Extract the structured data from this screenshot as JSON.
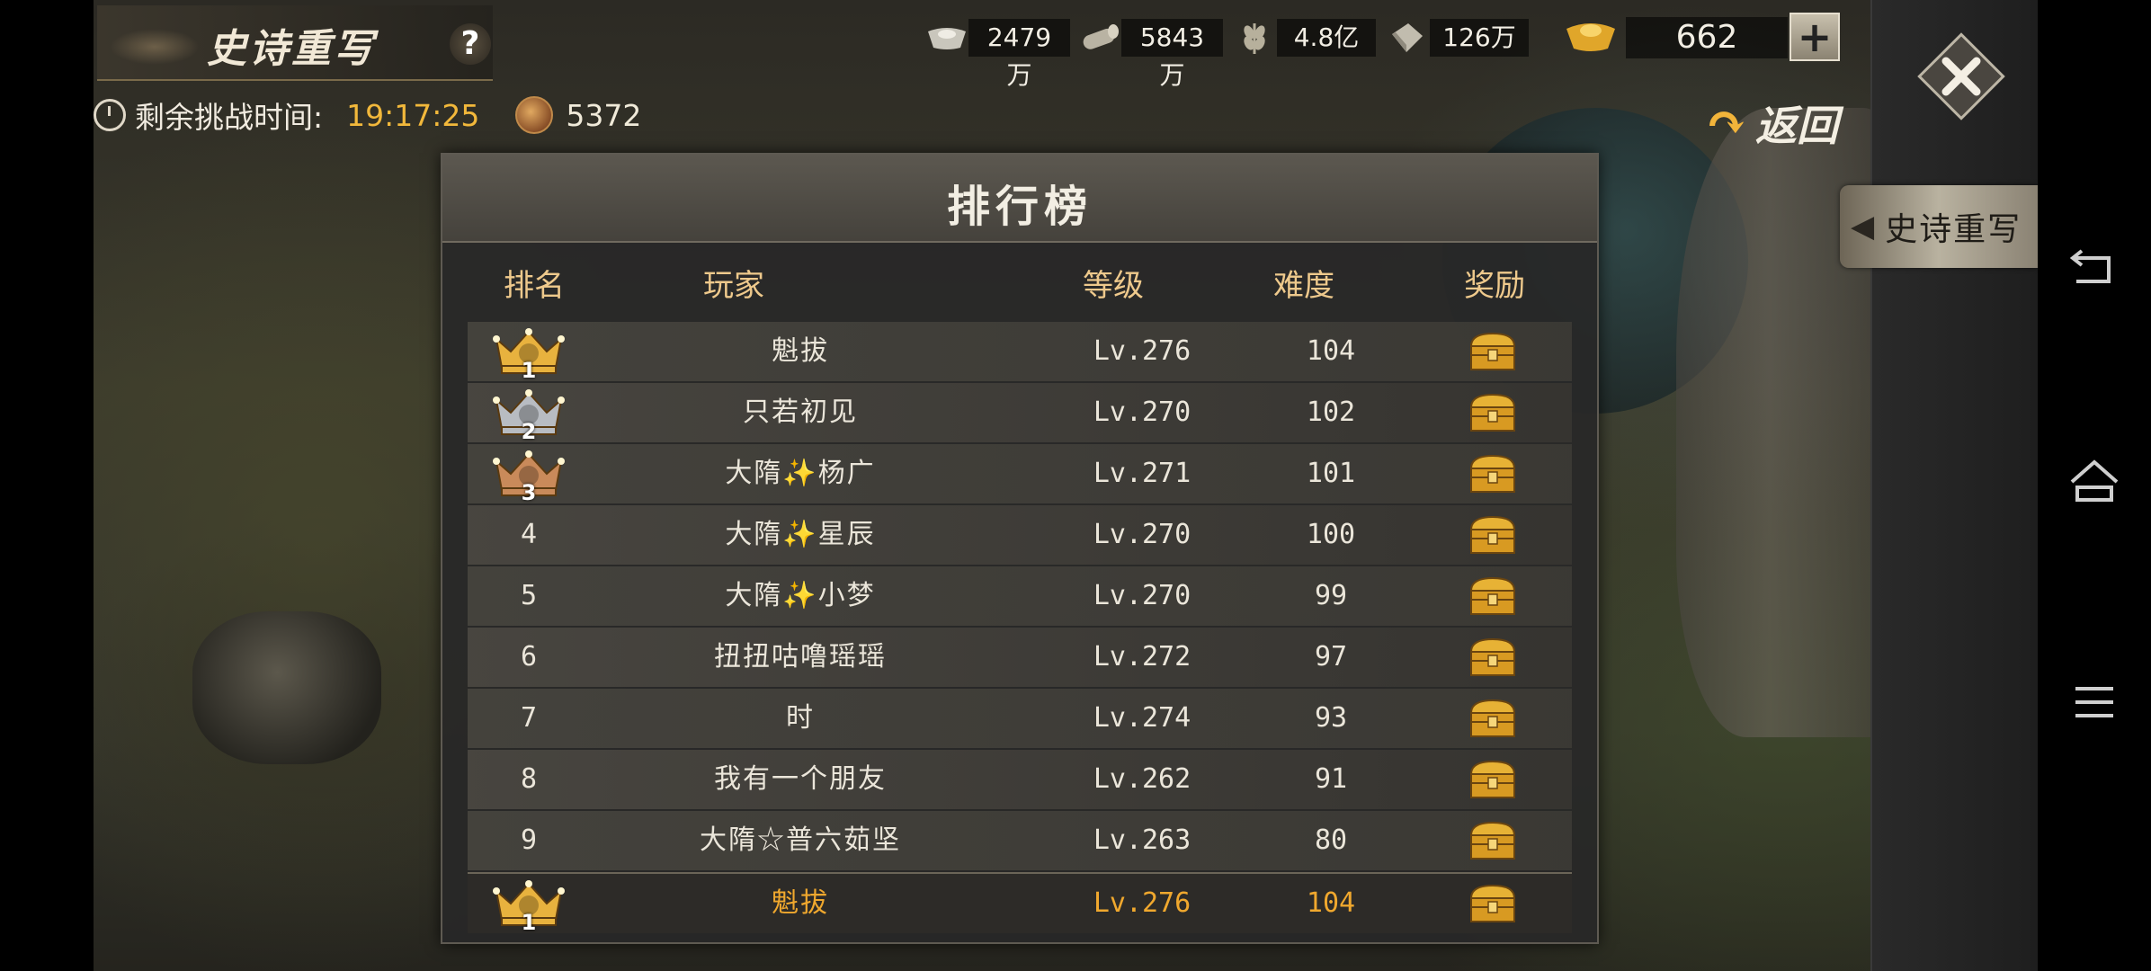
{
  "header": {
    "title": "史诗重写",
    "help_label": "?",
    "timer_label": "剩余挑战时间:",
    "timer_value": "19:17:25",
    "coin_value": "5372",
    "back_label": "返回",
    "epic_tab_label": "史诗重写"
  },
  "resources": [
    {
      "icon": "silver-ingot-icon",
      "value": "2479万"
    },
    {
      "icon": "wood-log-icon",
      "value": "5843万"
    },
    {
      "icon": "grain-icon",
      "value": "4.8亿"
    },
    {
      "icon": "iron-icon",
      "value": "126万"
    }
  ],
  "gold": {
    "icon": "gold-ingot-icon",
    "value": "662",
    "add_label": "+"
  },
  "ranking": {
    "title": "排行榜",
    "columns": {
      "rank": "排名",
      "player": "玩家",
      "level": "等级",
      "difficulty": "难度",
      "reward": "奖励"
    },
    "rows": [
      {
        "rank": "1",
        "crown": "gold",
        "player": "魁拔",
        "level": "Lv.276",
        "difficulty": "104"
      },
      {
        "rank": "2",
        "crown": "silver",
        "player": "只若初见",
        "level": "Lv.270",
        "difficulty": "102"
      },
      {
        "rank": "3",
        "crown": "bronze",
        "player": "大隋✨杨广",
        "level": "Lv.271",
        "difficulty": "101"
      },
      {
        "rank": "4",
        "crown": "",
        "player": "大隋✨星辰",
        "level": "Lv.270",
        "difficulty": "100"
      },
      {
        "rank": "5",
        "crown": "",
        "player": "大隋✨小梦",
        "level": "Lv.270",
        "difficulty": "99"
      },
      {
        "rank": "6",
        "crown": "",
        "player": "扭扭咕噜瑶瑶",
        "level": "Lv.272",
        "difficulty": "97"
      },
      {
        "rank": "7",
        "crown": "",
        "player": "时",
        "level": "Lv.274",
        "difficulty": "93"
      },
      {
        "rank": "8",
        "crown": "",
        "player": "我有一个朋友",
        "level": "Lv.262",
        "difficulty": "91"
      },
      {
        "rank": "9",
        "crown": "",
        "player": "大隋☆普六茹坚",
        "level": "Lv.263",
        "difficulty": "80"
      }
    ],
    "self_row": {
      "rank": "1",
      "crown": "gold",
      "player": "魁拔",
      "level": "Lv.276",
      "difficulty": "104"
    }
  },
  "colors": {
    "gold_crown": "#e8b23e",
    "silver_crown": "#b8bcc2",
    "bronze_crown": "#c98a5a",
    "highlight": "#f0a82e",
    "timer": "#f2b83b"
  }
}
